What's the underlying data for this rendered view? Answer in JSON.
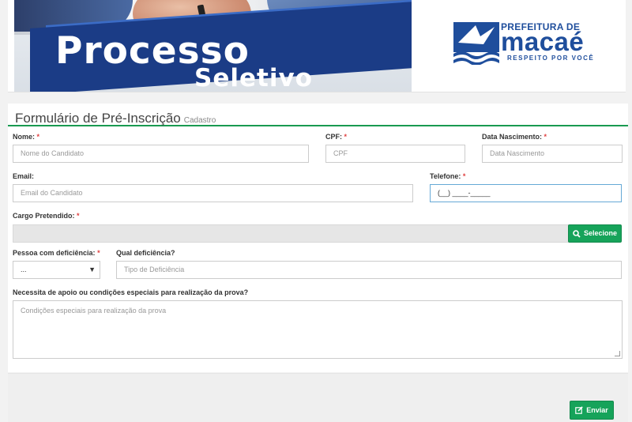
{
  "banner": {
    "line1": "Processo",
    "line2": "Seletivo"
  },
  "logo": {
    "top": "PREFEITURA DE",
    "city": "macaé",
    "tagline": "RESPEITO POR VOCÊ"
  },
  "form": {
    "title": "Formulário de Pré-Inscrição",
    "subtitle": "Cadastro",
    "required_mark": "*",
    "fields": {
      "nome": {
        "label": "Nome:",
        "placeholder": "Nome do Candidato"
      },
      "cpf": {
        "label": "CPF:",
        "placeholder": "CPF"
      },
      "nascimento": {
        "label": "Data Nascimento:",
        "placeholder": "Data Nascimento"
      },
      "email": {
        "label": "Email:",
        "placeholder": "Email do Candidato"
      },
      "telefone": {
        "label": "Telefone:",
        "value": "(__) ____-_____"
      },
      "cargo": {
        "label": "Cargo Pretendido:",
        "value": ""
      },
      "deficiencia": {
        "label": "Pessoa com deficiência:",
        "value": "..."
      },
      "qual": {
        "label": "Qual deficiência?",
        "placeholder": "Tipo de Deficiência"
      },
      "apoio": {
        "label": "Necessita de apoio ou condições especiais para realização da prova?",
        "placeholder": "Condições especiais para realização da prova"
      }
    },
    "select_button": "Selecione",
    "submit_button": "Enviar"
  },
  "colors": {
    "accent_green": "#16a35a",
    "title_rule": "#1a9a51",
    "brand_blue": "#1f4e9c",
    "required": "#e04040"
  },
  "icons": {
    "search": "search-icon",
    "edit": "edit-icon",
    "dropdown": "chevron-down-icon"
  }
}
